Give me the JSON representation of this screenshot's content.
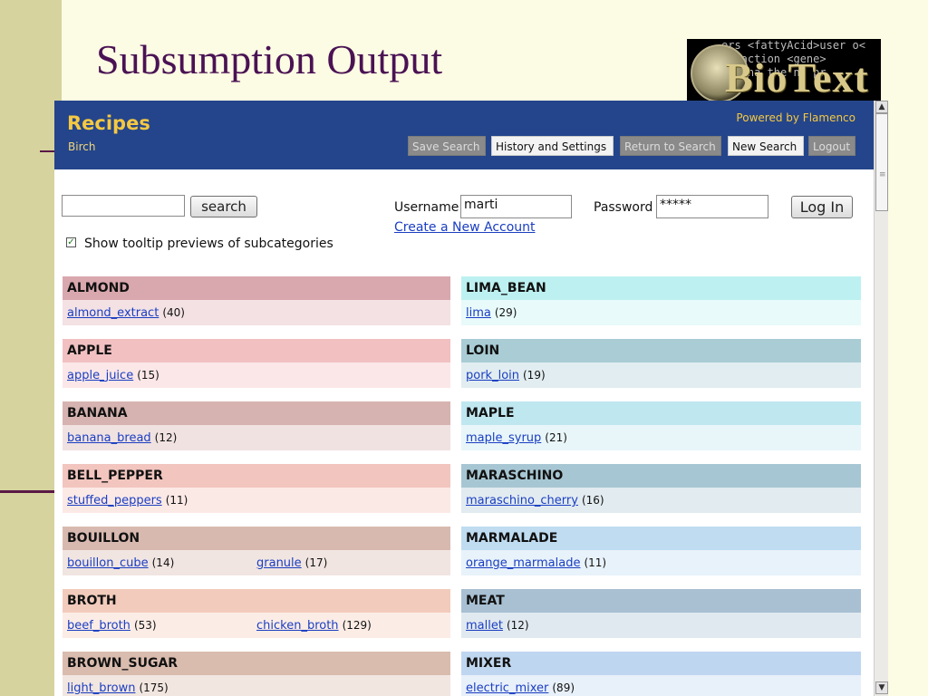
{
  "slide": {
    "title": "Subsumption Output",
    "logo": {
      "text": "BioText",
      "code_lines": [
        "ers <fattyAcid>user o<",
        " eraction <gene>",
        " ts na the na pr"
      ]
    }
  },
  "app": {
    "title": "Recipes",
    "subtitle": "Birch",
    "powered_by": "Powered by Flamenco",
    "buttons": {
      "save_search": "Save Search",
      "history_settings": "History and Settings",
      "return_search": "Return to Search",
      "new_search": "New Search",
      "logout": "Logout"
    }
  },
  "search": {
    "value": "",
    "button": "search",
    "tooltip_checkbox_checked": true,
    "tooltip_label": "Show tooltip previews of subcategories"
  },
  "login": {
    "username_label": "Username",
    "username_value": "marti",
    "password_label": "Password",
    "password_value": "*****",
    "login_button": "Log In",
    "create_account": "Create a New Account"
  },
  "categories_left": [
    {
      "name": "ALMOND",
      "head_color": "#d9a8ae",
      "body_color": "#f3e1e4",
      "items": [
        {
          "label": "almond_extract",
          "count": "(40)"
        }
      ]
    },
    {
      "name": "APPLE",
      "head_color": "#f2c0c1",
      "body_color": "#fbe7e8",
      "items": [
        {
          "label": "apple_juice",
          "count": "(15)"
        }
      ]
    },
    {
      "name": "BANANA",
      "head_color": "#d6b3b0",
      "body_color": "#f0e2e1",
      "items": [
        {
          "label": "banana_bread",
          "count": "(12)"
        }
      ]
    },
    {
      "name": "BELL_PEPPER",
      "head_color": "#f2c5bf",
      "body_color": "#fbe9e6",
      "items": [
        {
          "label": "stuffed_peppers",
          "count": "(11)"
        }
      ]
    },
    {
      "name": "BOUILLON",
      "head_color": "#d8b9b0",
      "body_color": "#f1e5e1",
      "items": [
        {
          "label": "bouillon_cube",
          "count": "(14)"
        },
        {
          "label": "granule",
          "count": "(17)"
        }
      ]
    },
    {
      "name": "BROTH",
      "head_color": "#f2cbbc",
      "body_color": "#fbece6",
      "items": [
        {
          "label": "beef_broth",
          "count": "(53)"
        },
        {
          "label": "chicken_broth",
          "count": "(129)"
        }
      ]
    },
    {
      "name": "BROWN_SUGAR",
      "head_color": "#d9bcae",
      "body_color": "#f2e6e0",
      "items": [
        {
          "label": "light_brown",
          "count": "(175)"
        }
      ]
    }
  ],
  "categories_right": [
    {
      "name": "LIMA_BEAN",
      "head_color": "#bdf1f1",
      "body_color": "#e8fafa",
      "items": [
        {
          "label": "lima",
          "count": "(29)"
        }
      ]
    },
    {
      "name": "LOIN",
      "head_color": "#a9ccd5",
      "body_color": "#e1edf0",
      "items": [
        {
          "label": "pork_loin",
          "count": "(19)"
        }
      ]
    },
    {
      "name": "MAPLE",
      "head_color": "#bfe7f0",
      "body_color": "#e8f6f9",
      "items": [
        {
          "label": "maple_syrup",
          "count": "(21)"
        }
      ]
    },
    {
      "name": "MARASCHINO",
      "head_color": "#a7c6d3",
      "body_color": "#e1ebf0",
      "items": [
        {
          "label": "maraschino_cherry",
          "count": "(16)"
        }
      ]
    },
    {
      "name": "MARMALADE",
      "head_color": "#bfdcf1",
      "body_color": "#e8f2fa",
      "items": [
        {
          "label": "orange_marmalade",
          "count": "(11)"
        }
      ]
    },
    {
      "name": "MEAT",
      "head_color": "#a8c0d2",
      "body_color": "#e1e9f0",
      "items": [
        {
          "label": "mallet",
          "count": "(12)"
        }
      ]
    },
    {
      "name": "MIXER",
      "head_color": "#bfd6f0",
      "body_color": "#e8f0fa",
      "items": [
        {
          "label": "electric_mixer",
          "count": "(89)"
        }
      ]
    }
  ]
}
